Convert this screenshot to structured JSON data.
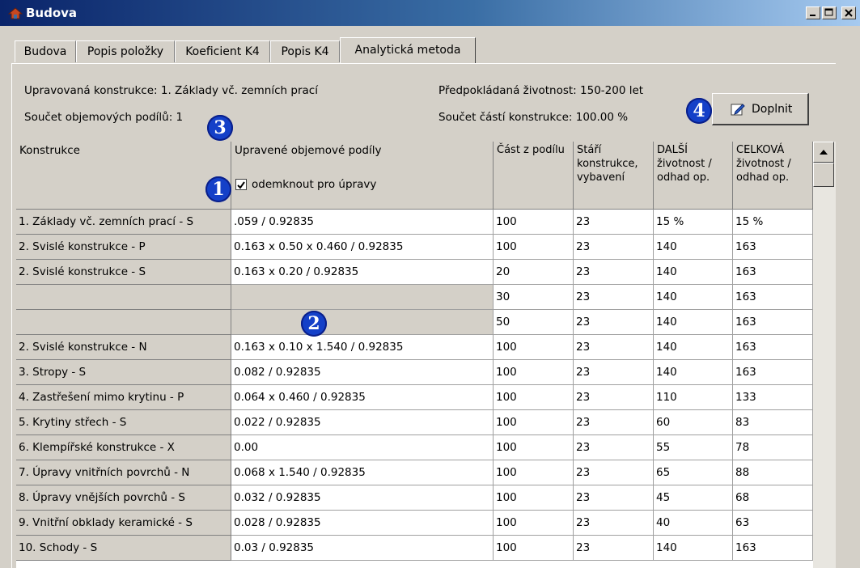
{
  "window": {
    "title": "Budova"
  },
  "tabs": [
    {
      "label": "Budova"
    },
    {
      "label": "Popis položky"
    },
    {
      "label": "Koeficient K4"
    },
    {
      "label": "Popis K4"
    },
    {
      "label": "Analytická metoda"
    }
  ],
  "info": {
    "construction_label": "Upravovaná konstrukce:",
    "construction_value": "1. Základy vč. zemních prací",
    "lifetime_label": "Předpokládaná životnost:",
    "lifetime_value": "150-200 let",
    "volume_sum_label": "Součet objemových podílů:",
    "volume_sum_value": "1",
    "parts_sum_label": "Součet částí konstrukce:",
    "parts_sum_value": "100.00 %"
  },
  "doplnit_button": {
    "label": "Doplnit"
  },
  "badges": [
    "1",
    "2",
    "3",
    "4"
  ],
  "columns": [
    "Konstrukce",
    "Upravené objemové podíly",
    "Část z podílu",
    "Stáří konstrukce, vybavení",
    "DALŠÍ životnost / odhad op.",
    "CELKOVÁ životnost / odhad op."
  ],
  "unlock_checkbox": {
    "label": "odemknout pro úpravy",
    "checked": true
  },
  "rows": [
    {
      "name": "1. Základy vč. zemních prací - S",
      "formula": ".059 / 0.92835",
      "part": "100",
      "age": "23",
      "next": "15 %",
      "total": "15 %"
    },
    {
      "name": "2. Svislé konstrukce - P",
      "formula": "0.163 x 0.50 x 0.460 / 0.92835",
      "part": "100",
      "age": "23",
      "next": "140",
      "total": "163"
    },
    {
      "name": "2. Svislé konstrukce - S",
      "formula": "0.163 x 0.20 / 0.92835",
      "part": "20",
      "age": "23",
      "next": "140",
      "total": "163"
    },
    {
      "name": "",
      "formula": "",
      "part": "30",
      "age": "23",
      "next": "140",
      "total": "163"
    },
    {
      "name": "",
      "formula": "",
      "part": "50",
      "age": "23",
      "next": "140",
      "total": "163"
    },
    {
      "name": "2. Svislé konstrukce - N",
      "formula": "0.163 x 0.10 x 1.540 / 0.92835",
      "part": "100",
      "age": "23",
      "next": "140",
      "total": "163"
    },
    {
      "name": "3. Stropy - S",
      "formula": "0.082 / 0.92835",
      "part": "100",
      "age": "23",
      "next": "140",
      "total": "163"
    },
    {
      "name": "4. Zastřešení mimo krytinu - P",
      "formula": "0.064 x 0.460 / 0.92835",
      "part": "100",
      "age": "23",
      "next": "110",
      "total": "133"
    },
    {
      "name": "5. Krytiny střech - S",
      "formula": "0.022 / 0.92835",
      "part": "100",
      "age": "23",
      "next": "60",
      "total": "83"
    },
    {
      "name": "6. Klempířské konstrukce - X",
      "formula": "0.00",
      "part": "100",
      "age": "23",
      "next": "55",
      "total": "78"
    },
    {
      "name": "7. Úpravy vnitřních povrchů - N",
      "formula": "0.068 x 1.540 / 0.92835",
      "part": "100",
      "age": "23",
      "next": "65",
      "total": "88"
    },
    {
      "name": "8. Úpravy vnějších povrchů - S",
      "formula": "0.032 / 0.92835",
      "part": "100",
      "age": "23",
      "next": "45",
      "total": "68"
    },
    {
      "name": "9. Vnitřní obklady keramické - S",
      "formula": "0.028 / 0.92835",
      "part": "100",
      "age": "23",
      "next": "40",
      "total": "63"
    },
    {
      "name": "10. Schody - S",
      "formula": "0.03 / 0.92835",
      "part": "100",
      "age": "23",
      "next": "140",
      "total": "163"
    }
  ]
}
